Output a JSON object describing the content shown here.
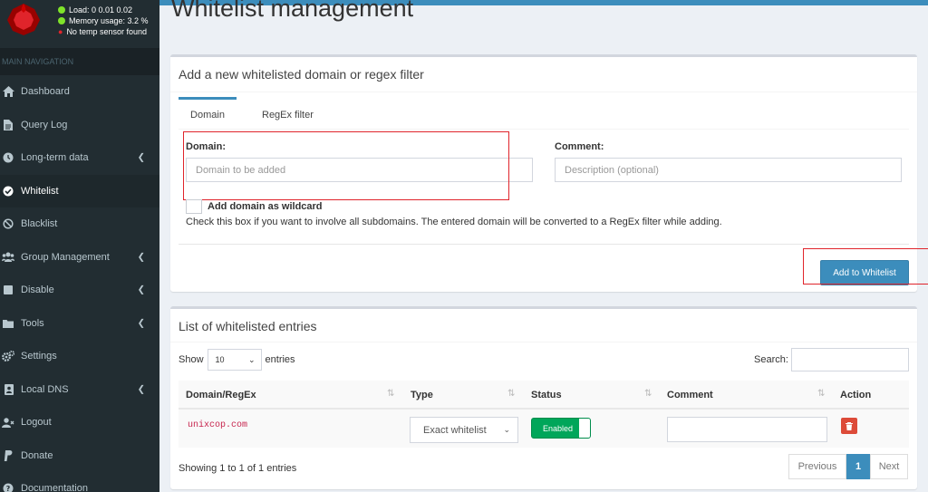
{
  "sidebar": {
    "status": {
      "load": "Load:  0  0.01  0.02",
      "memory": "Memory usage:  3.2 %",
      "temp": "No temp sensor found"
    },
    "nav_header": "MAIN NAVIGATION",
    "items": [
      {
        "label": "Dashboard",
        "icon": "home-icon"
      },
      {
        "label": "Query Log",
        "icon": "file-icon"
      },
      {
        "label": "Long-term data",
        "icon": "history-icon"
      },
      {
        "label": "Whitelist",
        "icon": "check-circle-icon"
      },
      {
        "label": "Blacklist",
        "icon": "ban-icon"
      },
      {
        "label": "Group Management",
        "icon": "users-icon"
      },
      {
        "label": "Disable",
        "icon": "stop-icon"
      },
      {
        "label": "Tools",
        "icon": "folder-icon"
      },
      {
        "label": "Settings",
        "icon": "cogs-icon"
      },
      {
        "label": "Local DNS",
        "icon": "address-book-icon"
      },
      {
        "label": "Logout",
        "icon": "user-times-icon"
      },
      {
        "label": "Donate",
        "icon": "paypal-icon"
      },
      {
        "label": "Documentation",
        "icon": "question-circle-icon"
      }
    ]
  },
  "page": {
    "title": "Whitelist management"
  },
  "add_box": {
    "title": "Add a new whitelisted domain or regex filter",
    "tabs": [
      "Domain",
      "RegEx filter"
    ],
    "domain_label": "Domain:",
    "domain_placeholder": "Domain to be added",
    "comment_label": "Comment:",
    "comment_placeholder": "Description (optional)",
    "wildcard_label": "Add domain as wildcard",
    "wildcard_hint": "Check this box if you want to involve all subdomains. The entered domain will be converted to a RegEx filter while adding.",
    "add_button": "Add to Whitelist"
  },
  "list_box": {
    "title": "List of whitelisted entries",
    "show_label": "Show",
    "page_size": "10",
    "entries_label": "entries",
    "search_label": "Search:",
    "columns": [
      "Domain/RegEx",
      "Type",
      "Status",
      "Comment",
      "Action"
    ],
    "rows": [
      {
        "domain": "unixcop.com",
        "type": "Exact whitelist",
        "status": "Enabled",
        "comment": ""
      }
    ],
    "info": "Showing 1 to 1 of 1 entries",
    "pagination": {
      "previous": "Previous",
      "current": "1",
      "next": "Next"
    }
  },
  "colors": {
    "primary": "#3c8dbc",
    "sidebar": "#222d32",
    "success": "#00a65a",
    "danger": "#dd4b39",
    "highlight": "#e0242b"
  }
}
